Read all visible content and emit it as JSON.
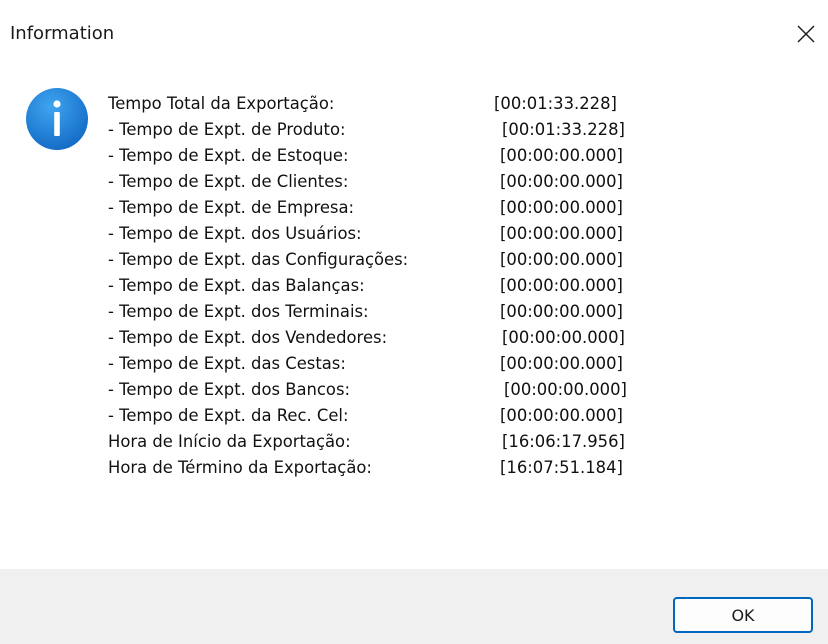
{
  "window": {
    "title": "Information",
    "icon": "info-icon",
    "close_icon": "close-icon"
  },
  "message": {
    "rows": [
      {
        "label": "Tempo Total da Exportação:",
        "value": "[00:01:33.228]"
      },
      {
        "label": "- Tempo de Expt. de Produto:",
        "value": "[00:01:33.228]"
      },
      {
        "label": "- Tempo de Expt. de Estoque:",
        "value": "[00:00:00.000]"
      },
      {
        "label": "- Tempo de Expt. de Clientes:",
        "value": "[00:00:00.000]"
      },
      {
        "label": "- Tempo de Expt. de Empresa:",
        "value": "[00:00:00.000]"
      },
      {
        "label": "- Tempo de Expt. dos Usuários:",
        "value": "[00:00:00.000]"
      },
      {
        "label": "- Tempo de Expt. das Configurações:",
        "value": "[00:00:00.000]"
      },
      {
        "label": "- Tempo de Expt. das Balanças:",
        "value": "[00:00:00.000]"
      },
      {
        "label": "- Tempo de Expt. dos Terminais:",
        "value": "[00:00:00.000]"
      },
      {
        "label": "- Tempo de Expt. dos Vendedores:",
        "value": "[00:00:00.000]"
      },
      {
        "label": "- Tempo de Expt. das Cestas:",
        "value": "[00:00:00.000]"
      },
      {
        "label": "- Tempo de Expt. dos Bancos:",
        "value": "[00:00:00.000]"
      },
      {
        "label": "- Tempo de Expt. da Rec. Cel:",
        "value": "[00:00:00.000]"
      },
      {
        "label": "Hora de Início da Exportação:",
        "value": "[16:06:17.956]"
      },
      {
        "label": "Hora de Término da Exportação:",
        "value": "[16:07:51.184]"
      }
    ]
  },
  "buttons": {
    "ok_label": "OK"
  },
  "colors": {
    "accent": "#0067c0",
    "info_icon": "#1a7fd4",
    "footer_bg": "#f0f0f0"
  }
}
